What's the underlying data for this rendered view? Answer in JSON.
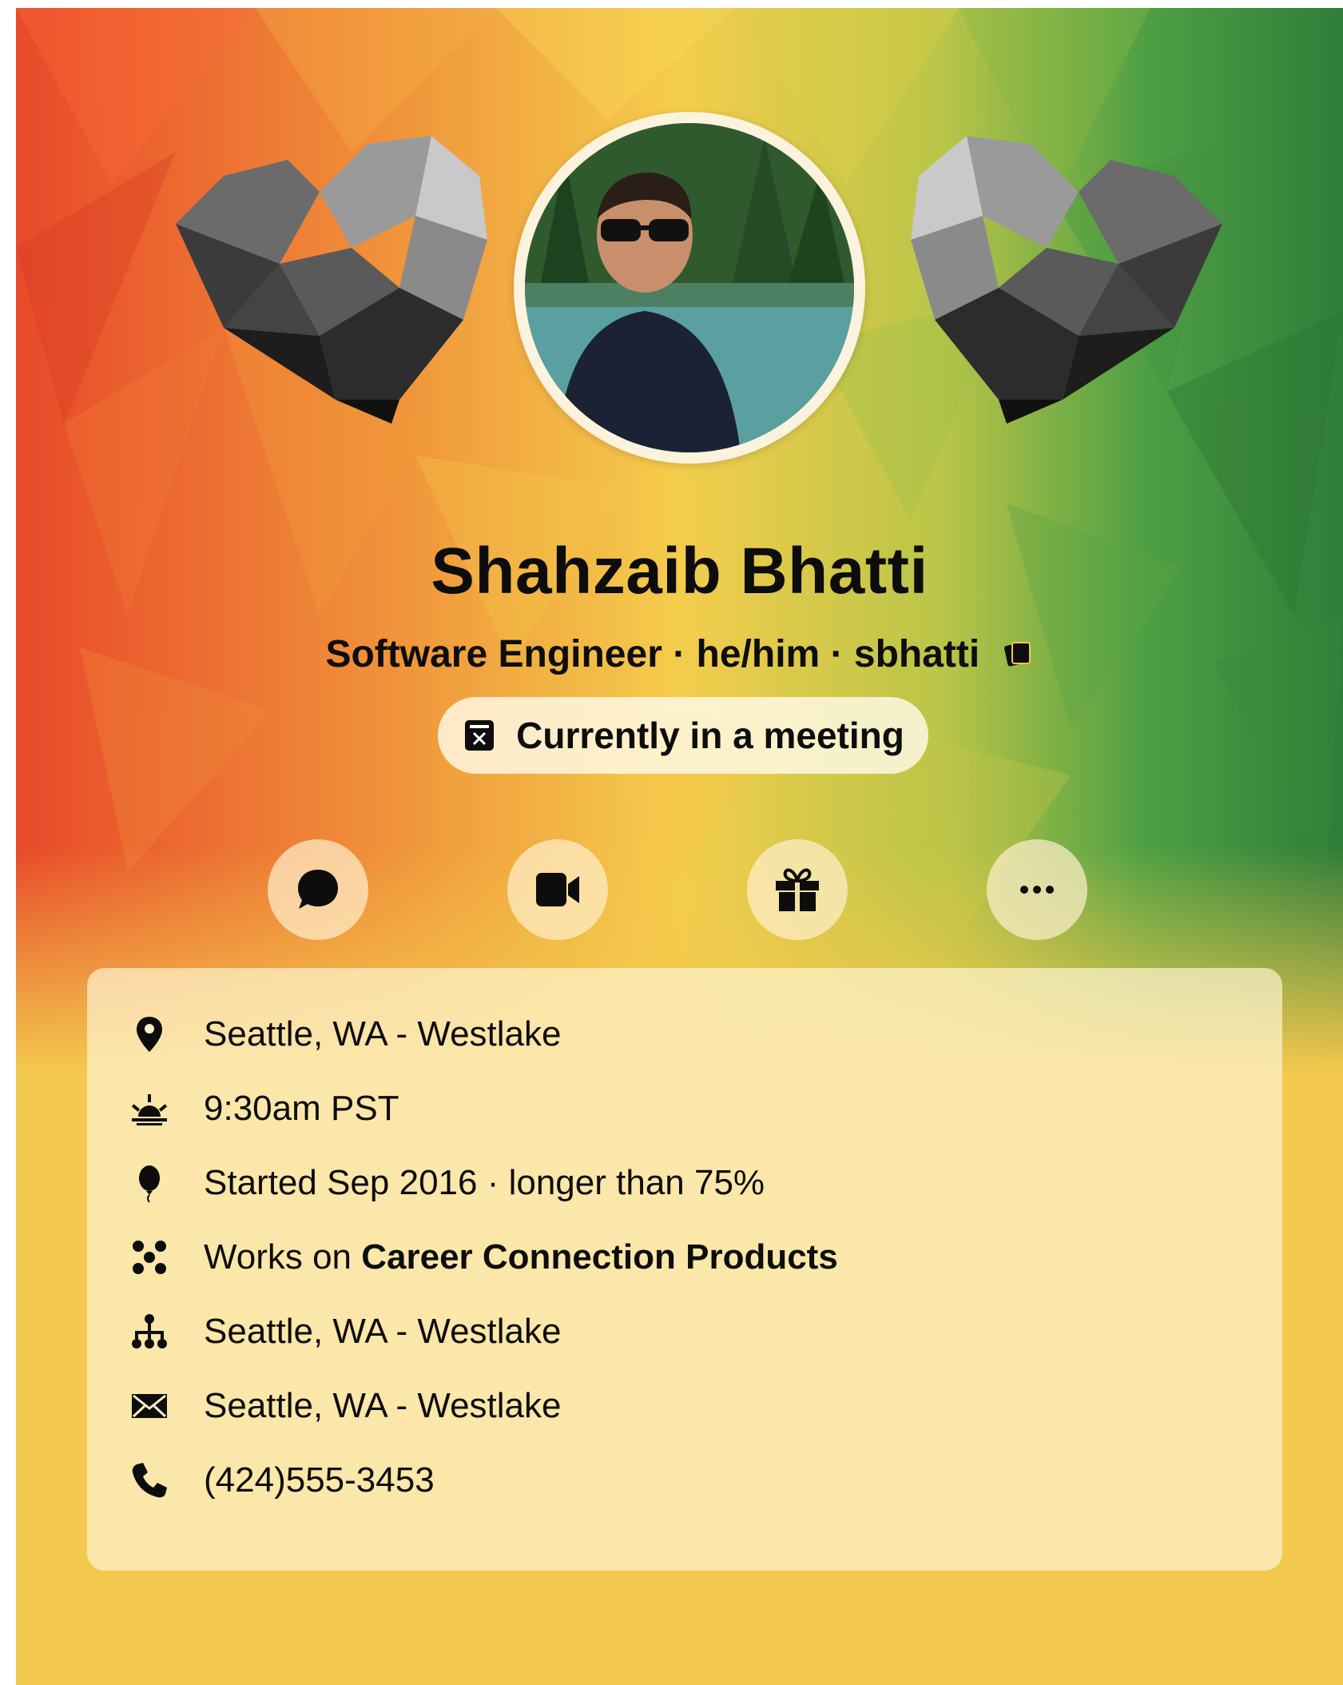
{
  "profile": {
    "name": "Shahzaib Bhatti",
    "title": "Software Engineer",
    "pronouns": "he/him",
    "username": "sbhatti",
    "separator": " · ",
    "status": "Currently in a meeting"
  },
  "actions": [
    {
      "icon": "chat-bubble-icon"
    },
    {
      "icon": "video-camera-icon"
    },
    {
      "icon": "gift-icon"
    },
    {
      "icon": "more-ellipsis-icon"
    }
  ],
  "details": {
    "location": "Seattle, WA - Westlake",
    "local_time": "9:30am PST",
    "tenure": "Started Sep 2016 · longer than 75%",
    "works_on_prefix": "Works on ",
    "works_on_team": "Career Connection Products",
    "org": "Seattle, WA - Westlake",
    "mail": "Seattle, WA - Westlake",
    "phone": "(424)555-3453"
  },
  "colors": {
    "card_background": "#f3c84e",
    "gradient_left": "#e8492a",
    "gradient_center": "#f4cd4c",
    "gradient_right": "#2f7d3a",
    "text": "#0d0d0d"
  }
}
